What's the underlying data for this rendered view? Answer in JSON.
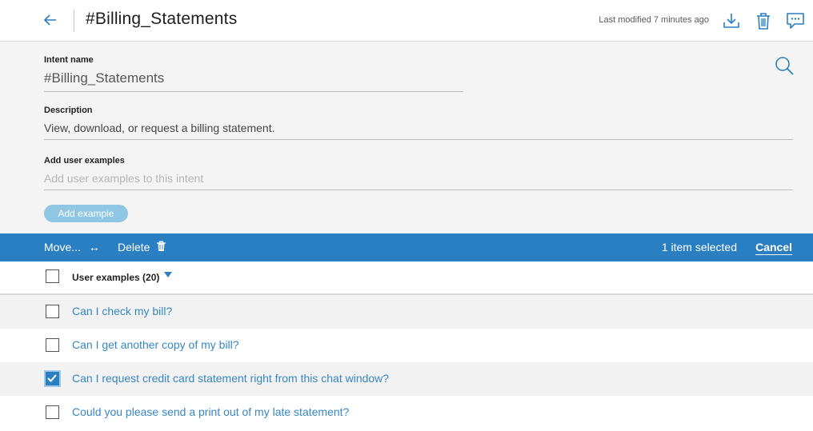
{
  "header": {
    "title": "#Billing_Statements",
    "last_modified": "Last modified 7 minutes ago"
  },
  "form": {
    "intent_label": "Intent name",
    "intent_value": "#Billing_Statements",
    "description_label": "Description",
    "description_value": "View, download, or request a billing statement.",
    "examples_label": "Add user examples",
    "examples_placeholder": "Add user examples to this intent",
    "add_button": "Add example"
  },
  "actionbar": {
    "move": "Move...",
    "move_arrow": "↔",
    "delete": "Delete",
    "selected": "1 item selected",
    "cancel": "Cancel"
  },
  "list": {
    "header": "User examples (20)",
    "items": [
      {
        "text": "Can I check my bill?",
        "checked": false
      },
      {
        "text": "Can I get another copy of my bill?",
        "checked": false
      },
      {
        "text": "Can I request credit card statement right from this chat window?",
        "checked": true
      },
      {
        "text": "Could you please send a print out of my late statement?",
        "checked": false
      }
    ]
  },
  "colors": {
    "accent": "#2a7fc3",
    "link": "#3886c3",
    "add_button": "#8fc6e3"
  }
}
